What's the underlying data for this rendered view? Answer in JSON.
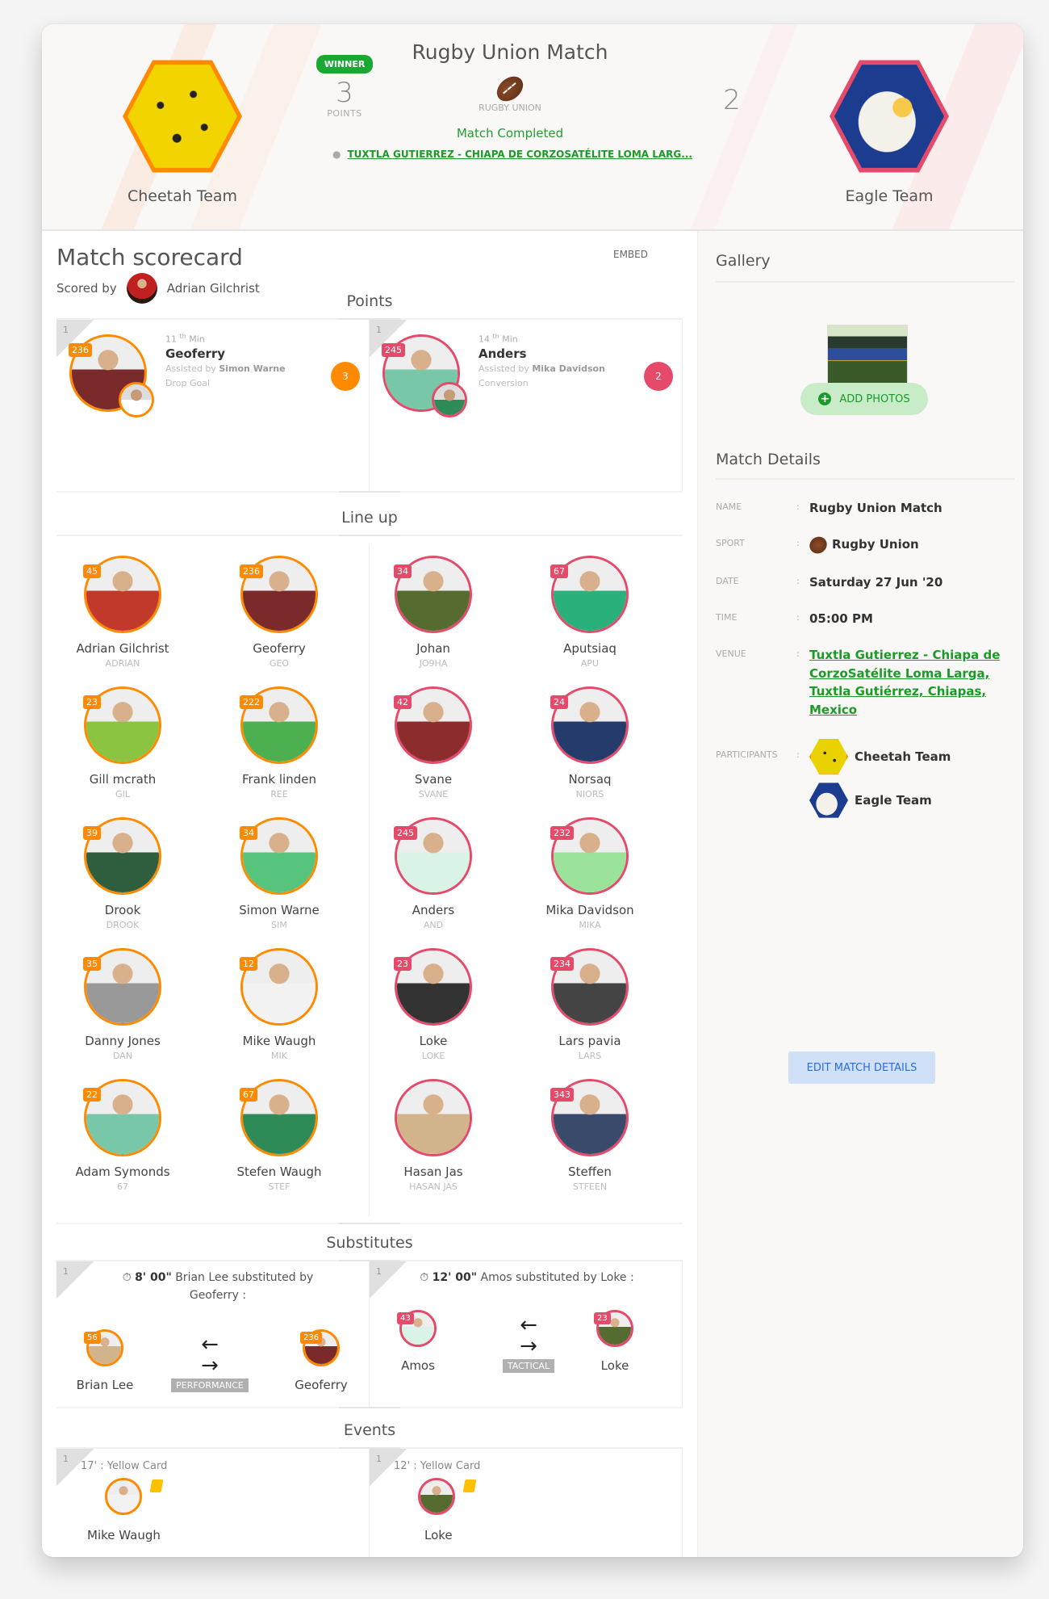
{
  "header": {
    "match_title": "Rugby Union Match",
    "home_team": {
      "name": "Cheetah Team",
      "score": "3",
      "score_label": "POINTS",
      "winner_label": "WINNER",
      "color": "#ff8a00"
    },
    "away_team": {
      "name": "Eagle Team",
      "score": "2",
      "color": "#e64a6b"
    },
    "sport_label": "RUGBY UNION",
    "status": "Match Completed",
    "venue_short": "TUXTLA GUTIERREZ - CHIAPA DE CORZOSATÉLITE LOMA LARG..."
  },
  "scorecard": {
    "title": "Match scorecard",
    "embed_label": "EMBED",
    "scored_by_label": "Scored by",
    "scorer_name": "Adrian Gilchrist"
  },
  "points": {
    "heading": "Points",
    "items": [
      {
        "period": "1",
        "minute": "11",
        "minute_suffix": "th",
        "minute_label": "Min",
        "player": "Geoferry",
        "number": "236",
        "assist_label": "Assisted by",
        "assist": "Simon Warne",
        "type": "Drop Goal",
        "points": "3",
        "side": "home"
      },
      {
        "period": "1",
        "minute": "14",
        "minute_suffix": "th",
        "minute_label": "Min",
        "player": "Anders",
        "number": "245",
        "assist_label": "Assisted by",
        "assist": "Mika Davidson",
        "type": "Conversion",
        "points": "2",
        "side": "away"
      }
    ]
  },
  "lineup": {
    "heading": "Line up",
    "home": [
      {
        "name": "Adrian Gilchrist",
        "short": "ADRIAN",
        "number": "45"
      },
      {
        "name": "Geoferry",
        "short": "GEO",
        "number": "236"
      },
      {
        "name": "Gill mcrath",
        "short": "GIL",
        "number": "23"
      },
      {
        "name": "Frank linden",
        "short": "REE",
        "number": "222"
      },
      {
        "name": "Drook",
        "short": "DROOK",
        "number": "39"
      },
      {
        "name": "Simon Warne",
        "short": "SIM",
        "number": "34"
      },
      {
        "name": "Danny Jones",
        "short": "DAN",
        "number": "35"
      },
      {
        "name": "Mike Waugh",
        "short": "MIK",
        "number": "12"
      },
      {
        "name": "Adam Symonds",
        "short": "67",
        "number": "22"
      },
      {
        "name": "Stefen Waugh",
        "short": "STEF",
        "number": "67"
      }
    ],
    "away": [
      {
        "name": "Johan",
        "short": "JO9HA",
        "number": "34"
      },
      {
        "name": "Aputsiaq",
        "short": "APU",
        "number": "67"
      },
      {
        "name": "Svane",
        "short": "SVANE",
        "number": "42"
      },
      {
        "name": "Norsaq",
        "short": "NIORS",
        "number": "24"
      },
      {
        "name": "Anders",
        "short": "AND",
        "number": "245"
      },
      {
        "name": "Mika Davidson",
        "short": "MIKA",
        "number": "232"
      },
      {
        "name": "Loke",
        "short": "LOKE",
        "number": "23"
      },
      {
        "name": "Lars pavia",
        "short": "LARS",
        "number": "234"
      },
      {
        "name": "Hasan Jas",
        "short": "HASAN JAS",
        "number": ""
      },
      {
        "name": "Steffen",
        "short": "STFEEN",
        "number": "343"
      }
    ]
  },
  "substitutes": {
    "heading": "Substitutes",
    "items": [
      {
        "period": "1",
        "time": "8' 00\"",
        "text": "Brian Lee substituted by Geoferry :",
        "out_name": "Brian Lee",
        "out_number": "56",
        "in_name": "Geoferry",
        "in_number": "236",
        "reason": "PERFORMANCE",
        "side": "home"
      },
      {
        "period": "1",
        "time": "12' 00\"",
        "text": "Amos substituted by Loke :",
        "out_name": "Amos",
        "out_number": "43",
        "in_name": "Loke",
        "in_number": "23",
        "reason": "TACTICAL",
        "side": "away"
      }
    ]
  },
  "events": {
    "heading": "Events",
    "items": [
      {
        "period": "1",
        "text": "17' : Yellow Card",
        "player": "Mike Waugh",
        "side": "home"
      },
      {
        "period": "1",
        "text": "12' : Yellow Card",
        "player": "Loke",
        "side": "away"
      }
    ]
  },
  "gallery": {
    "title": "Gallery",
    "add_photos_label": "ADD PHOTOS"
  },
  "match_details": {
    "title": "Match Details",
    "name_label": "NAME",
    "name": "Rugby Union Match",
    "sport_label": "SPORT",
    "sport": "Rugby Union",
    "date_label": "DATE",
    "date": "Saturday 27 Jun '20",
    "time_label": "TIME",
    "time": "05:00 PM",
    "venue_label": "VENUE",
    "venue": "Tuxtla Gutierrez - Chiapa de CorzoSatélite Loma Larga, Tuxtla Gutiérrez, Chiapas, Mexico",
    "participants_label": "PARTICIPANTS",
    "participants": [
      "Cheetah Team",
      "Eagle Team"
    ],
    "colon": ":",
    "edit_label": "EDIT MATCH DETAILS"
  }
}
